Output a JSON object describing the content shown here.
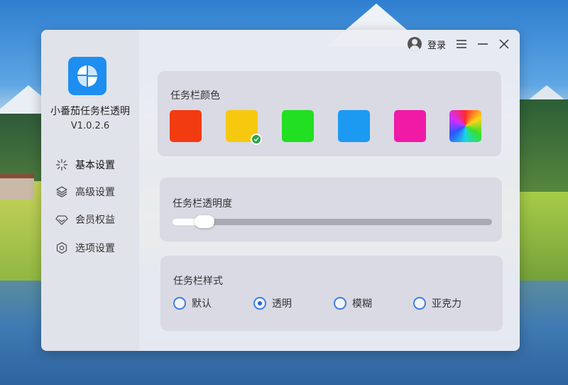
{
  "app": {
    "name": "小番茄任务栏透明",
    "version": "V1.0.2.6"
  },
  "titlebar": {
    "login_label": "登录"
  },
  "sidebar": {
    "items": [
      {
        "label": "基本设置",
        "icon": "sparkle-icon"
      },
      {
        "label": "高级设置",
        "icon": "layers-icon"
      },
      {
        "label": "会员权益",
        "icon": "diamond-icon"
      },
      {
        "label": "选项设置",
        "icon": "hexagon-icon"
      }
    ],
    "active_index": 0
  },
  "color_section": {
    "title": "任务栏颜色",
    "swatches": [
      "#f23b10",
      "#f6c90f",
      "#22df22",
      "#1c9af2",
      "#f01aa6",
      "rainbow"
    ],
    "selected_index": 1
  },
  "transparency_section": {
    "title": "任务栏透明度",
    "value_percent": 10
  },
  "style_section": {
    "title": "任务栏样式",
    "options": [
      "默认",
      "透明",
      "模糊",
      "亚克力"
    ],
    "selected_index": 1
  },
  "colors": {
    "accent": "#3d7fe0",
    "logo": "#1e8ef0",
    "check": "#2fa24a"
  }
}
